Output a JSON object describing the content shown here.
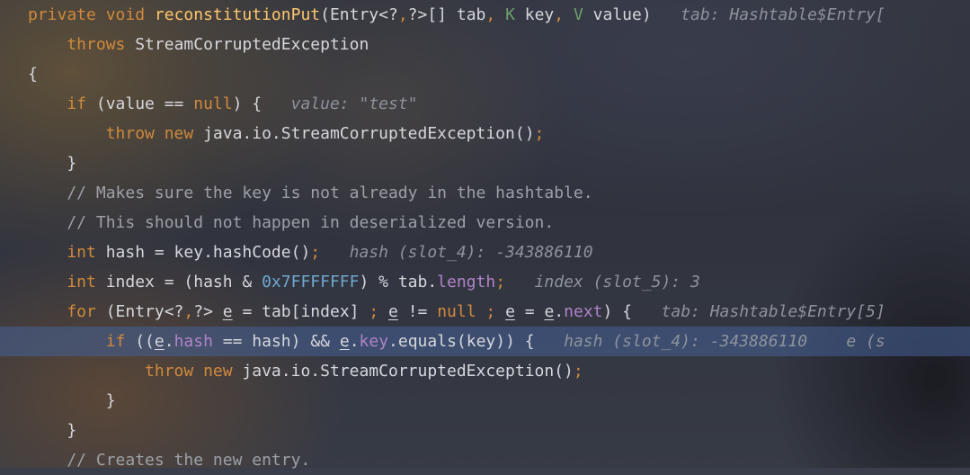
{
  "lines": [
    {
      "highlight": false,
      "tokens": [
        {
          "t": "private void ",
          "c": "kw"
        },
        {
          "t": "reconstitutionPut",
          "c": "fn"
        },
        {
          "t": "(Entry<?",
          "c": "pl"
        },
        {
          "t": ",",
          "c": "kw"
        },
        {
          "t": "?>[] tab",
          "c": "pl"
        },
        {
          "t": ", ",
          "c": "kw"
        },
        {
          "t": "K ",
          "c": "tp"
        },
        {
          "t": "key",
          "c": "pl"
        },
        {
          "t": ", ",
          "c": "kw"
        },
        {
          "t": "V ",
          "c": "tp"
        },
        {
          "t": "value)",
          "c": "pl"
        },
        {
          "t": "   tab: Hashtable$Entry[",
          "c": "hint"
        }
      ]
    },
    {
      "highlight": false,
      "tokens": [
        {
          "t": "    throws ",
          "c": "kw"
        },
        {
          "t": "StreamCorruptedException",
          "c": "pl"
        }
      ]
    },
    {
      "highlight": false,
      "tokens": [
        {
          "t": "{",
          "c": "pl"
        }
      ]
    },
    {
      "highlight": false,
      "tokens": [
        {
          "t": "    if ",
          "c": "kw"
        },
        {
          "t": "(value == ",
          "c": "pl"
        },
        {
          "t": "null",
          "c": "kw"
        },
        {
          "t": ") {",
          "c": "pl"
        },
        {
          "t": "   value: \"test\"",
          "c": "hint"
        }
      ]
    },
    {
      "highlight": false,
      "tokens": [
        {
          "t": "        throw new ",
          "c": "kw"
        },
        {
          "t": "java.io.StreamCorruptedException()",
          "c": "pl"
        },
        {
          "t": ";",
          "c": "kw"
        }
      ]
    },
    {
      "highlight": false,
      "tokens": [
        {
          "t": "    }",
          "c": "pl"
        }
      ]
    },
    {
      "highlight": false,
      "tokens": [
        {
          "t": "    // Makes sure the key is not already in the hashtable.",
          "c": "cmt"
        }
      ]
    },
    {
      "highlight": false,
      "tokens": [
        {
          "t": "    // This should not happen in deserialized version.",
          "c": "cmt"
        }
      ]
    },
    {
      "highlight": false,
      "tokens": [
        {
          "t": "    int ",
          "c": "kw"
        },
        {
          "t": "hash = key.hashCode()",
          "c": "pl"
        },
        {
          "t": ";",
          "c": "kw"
        },
        {
          "t": "   hash (slot_4): -343886110",
          "c": "hint"
        }
      ]
    },
    {
      "highlight": false,
      "tokens": [
        {
          "t": "    int ",
          "c": "kw"
        },
        {
          "t": "index = (hash & ",
          "c": "pl"
        },
        {
          "t": "0x7FFFFFFF",
          "c": "num"
        },
        {
          "t": ") % tab.",
          "c": "pl"
        },
        {
          "t": "length",
          "c": "fld"
        },
        {
          "t": ";",
          "c": "kw"
        },
        {
          "t": "   index (slot_5): 3",
          "c": "hint"
        }
      ]
    },
    {
      "highlight": false,
      "tokens": [
        {
          "t": "    for ",
          "c": "kw"
        },
        {
          "t": "(Entry<?",
          "c": "pl"
        },
        {
          "t": ",",
          "c": "kw"
        },
        {
          "t": "?> ",
          "c": "pl"
        },
        {
          "t": "e",
          "c": "pl ul"
        },
        {
          "t": " = tab[index] ",
          "c": "pl"
        },
        {
          "t": "; ",
          "c": "kw"
        },
        {
          "t": "e",
          "c": "pl ul"
        },
        {
          "t": " != ",
          "c": "pl"
        },
        {
          "t": "null ",
          "c": "kw"
        },
        {
          "t": "; ",
          "c": "kw"
        },
        {
          "t": "e",
          "c": "pl ul"
        },
        {
          "t": " = ",
          "c": "pl"
        },
        {
          "t": "e",
          "c": "pl ul"
        },
        {
          "t": ".",
          "c": "pl"
        },
        {
          "t": "next",
          "c": "fld"
        },
        {
          "t": ") {",
          "c": "pl"
        },
        {
          "t": "   tab: Hashtable$Entry[5]",
          "c": "hint"
        }
      ]
    },
    {
      "highlight": true,
      "tokens": [
        {
          "t": "        if ",
          "c": "kw"
        },
        {
          "t": "((",
          "c": "pl"
        },
        {
          "t": "e",
          "c": "pl ul"
        },
        {
          "t": ".",
          "c": "pl"
        },
        {
          "t": "hash",
          "c": "fld"
        },
        {
          "t": " == hash) && ",
          "c": "pl"
        },
        {
          "t": "e",
          "c": "pl ul"
        },
        {
          "t": ".",
          "c": "pl"
        },
        {
          "t": "key",
          "c": "fld"
        },
        {
          "t": ".equals(key)) {",
          "c": "pl"
        },
        {
          "t": "   hash (slot_4): -343886110    e (s",
          "c": "hint"
        }
      ]
    },
    {
      "highlight": false,
      "tokens": [
        {
          "t": "            throw new ",
          "c": "kw"
        },
        {
          "t": "java.io.StreamCorruptedException()",
          "c": "pl"
        },
        {
          "t": ";",
          "c": "kw"
        }
      ]
    },
    {
      "highlight": false,
      "tokens": [
        {
          "t": "        }",
          "c": "pl"
        }
      ]
    },
    {
      "highlight": false,
      "tokens": [
        {
          "t": "    }",
          "c": "pl"
        }
      ]
    },
    {
      "highlight": false,
      "tokens": [
        {
          "t": "    // Creates the new entry.",
          "c": "cmt"
        }
      ]
    }
  ]
}
